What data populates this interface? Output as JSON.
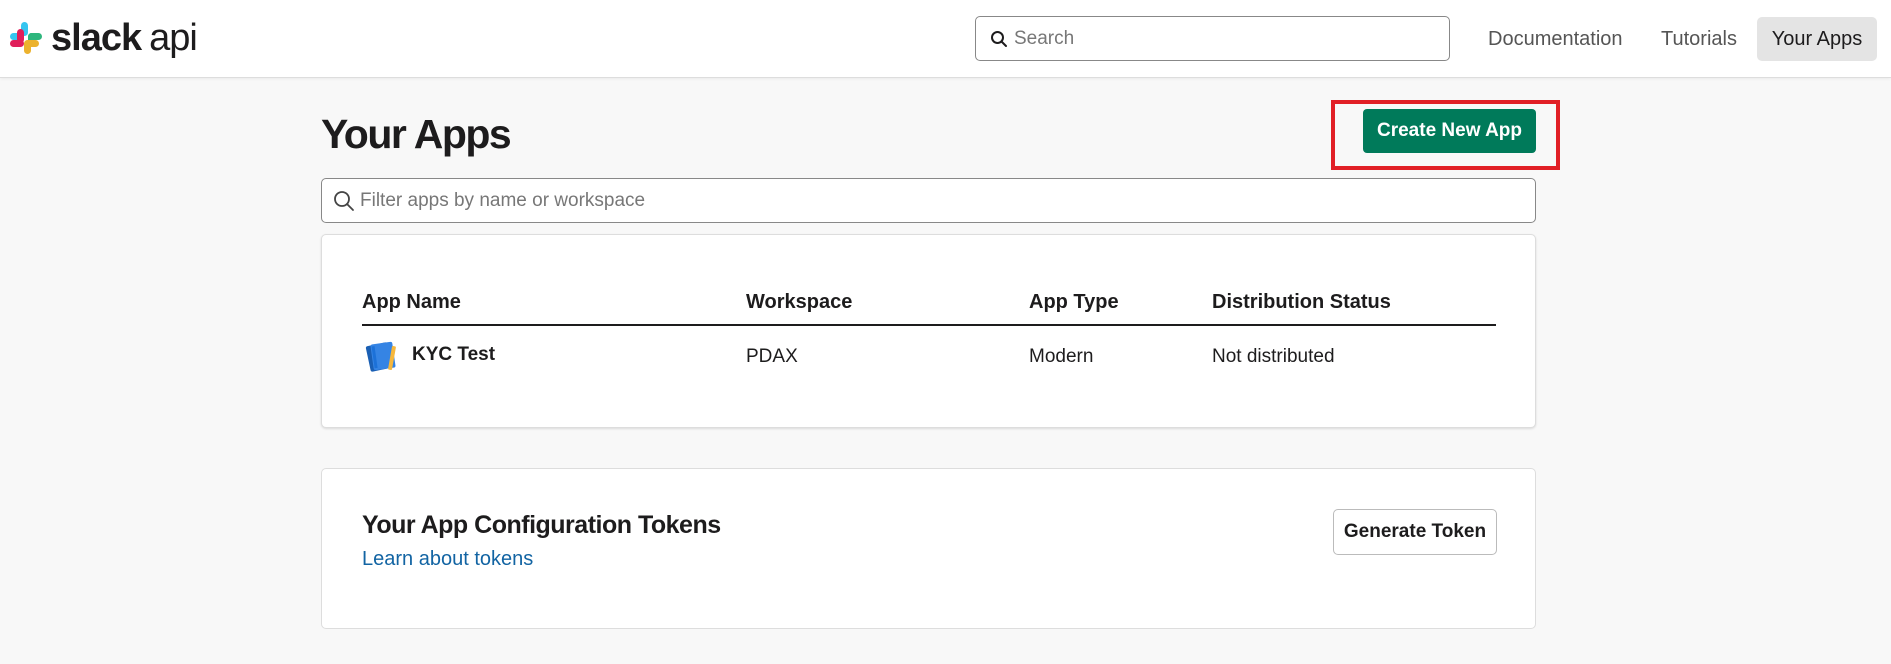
{
  "header": {
    "logo": {
      "brand": "slack",
      "product": "api",
      "icon": "slack-logo-icon"
    },
    "search": {
      "placeholder": "Search",
      "value": "",
      "icon": "search-icon"
    },
    "nav": {
      "documentation": "Documentation",
      "tutorials": "Tutorials",
      "your_apps": "Your Apps"
    }
  },
  "main": {
    "title": "Your Apps",
    "create_button": "Create New App",
    "filter": {
      "placeholder": "Filter apps by name or workspace",
      "value": "",
      "icon": "search-icon"
    },
    "apps_table": {
      "columns": [
        "App Name",
        "Workspace",
        "App Type",
        "Distribution Status"
      ],
      "rows": [
        {
          "name": "KYC Test",
          "workspace": "PDAX",
          "type": "Modern",
          "distribution": "Not distributed",
          "icon": "notebook-icon"
        }
      ]
    },
    "tokens": {
      "title": "Your App Configuration Tokens",
      "link": "Learn about tokens",
      "button": "Generate Token"
    }
  },
  "colors": {
    "primary_button": "#007a5a",
    "highlight_border": "#e11f26",
    "link": "#1264a3",
    "page_background": "#f8f8f8"
  }
}
